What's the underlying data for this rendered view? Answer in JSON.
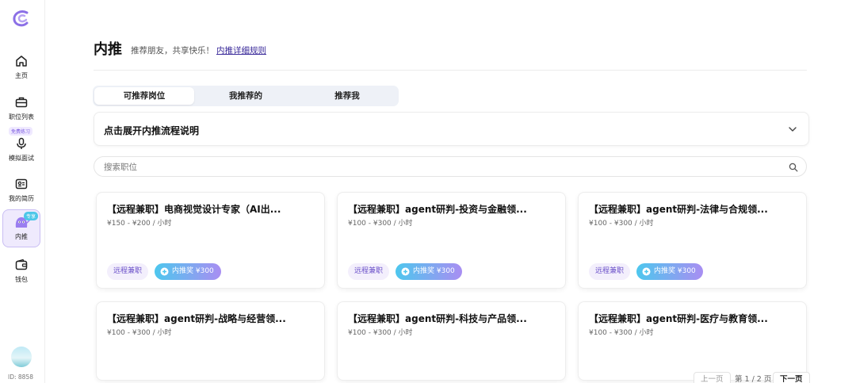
{
  "sidebar": {
    "items": [
      {
        "label": "主页",
        "icon": "home-icon"
      },
      {
        "label": "职位列表",
        "icon": "briefcase-icon"
      },
      {
        "label": "模拟面试",
        "icon": "microphone-icon",
        "badge": "免费练习"
      },
      {
        "label": "我的简历",
        "icon": "resume-icon"
      },
      {
        "label": "内推",
        "icon": "mascot-icon",
        "badge": "专享"
      },
      {
        "label": "钱包",
        "icon": "wallet-icon"
      }
    ],
    "user_id": "ID: 8858"
  },
  "header": {
    "title": "内推",
    "subtitle": "推荐朋友，共享快乐！",
    "rules_link": "内推详细规则"
  },
  "tabs": [
    "可推荐岗位",
    "我推荐的",
    "推荐我"
  ],
  "accordion": {
    "title": "点击展开内推流程说明"
  },
  "search": {
    "placeholder": "搜索职位"
  },
  "cards": [
    {
      "title": "【远程兼职】电商视觉设计专家（AI出...",
      "salary": "¥150 - ¥200 / 小时",
      "tag": "远程兼职",
      "reward": "内推奖 ¥300"
    },
    {
      "title": "【远程兼职】agent研判-投资与金融领...",
      "salary": "¥100 - ¥300 / 小时",
      "tag": "远程兼职",
      "reward": "内推奖 ¥300"
    },
    {
      "title": "【远程兼职】agent研判-法律与合规领...",
      "salary": "¥100 - ¥300 / 小时",
      "tag": "远程兼职",
      "reward": "内推奖 ¥300"
    },
    {
      "title": "【远程兼职】agent研判-战略与经营领...",
      "salary": "¥100 - ¥300 / 小时"
    },
    {
      "title": "【远程兼职】agent研判-科技与产品领...",
      "salary": "¥100 - ¥300 / 小时"
    },
    {
      "title": "【远程兼职】agent研判-医疗与教育领...",
      "salary": "¥100 - ¥300 / 小时"
    }
  ],
  "pagination": {
    "prev": "上一页",
    "info": "第 1 / 2 页",
    "next": "下一页"
  },
  "colors": {
    "accent": "#7b5be0",
    "reward_gradient_start": "#4dc7ee",
    "reward_gradient_end": "#a98ef2"
  }
}
